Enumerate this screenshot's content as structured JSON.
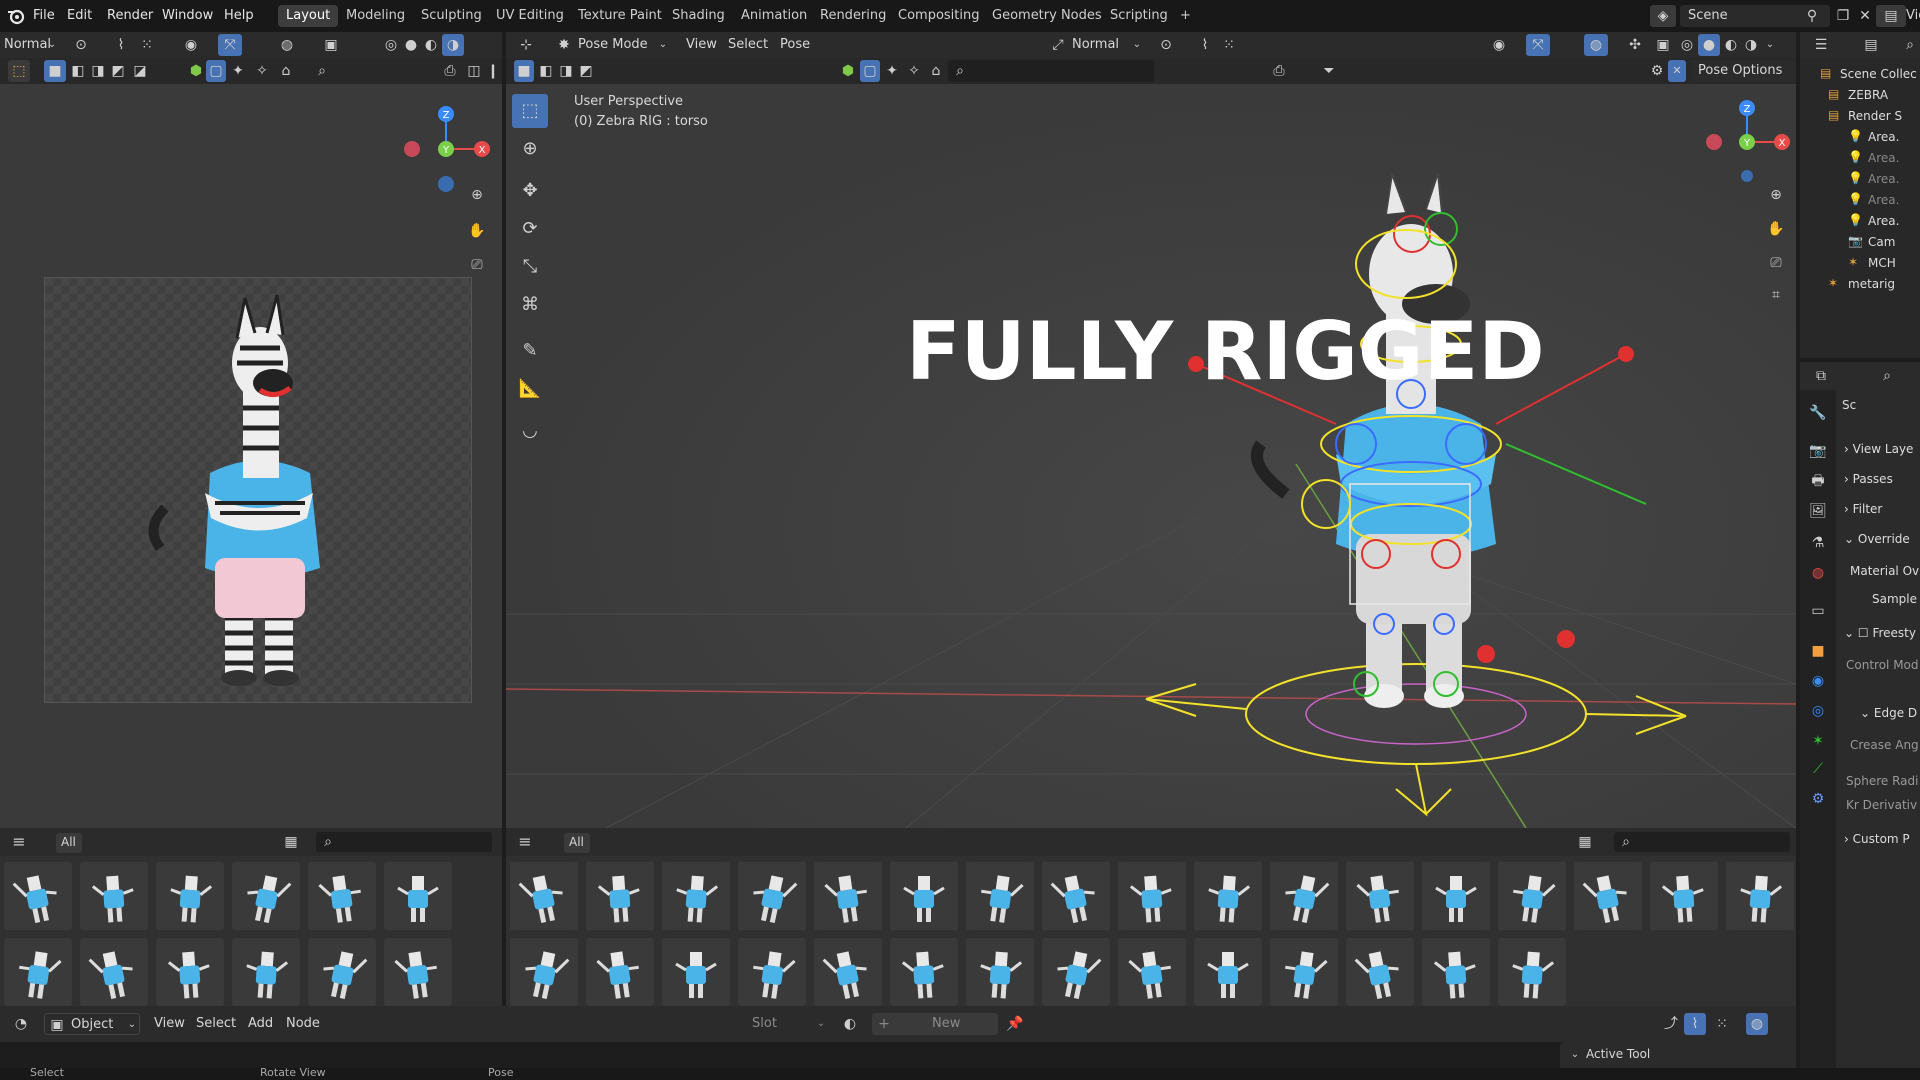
{
  "topbar": {
    "menus": [
      "File",
      "Edit",
      "Render",
      "Window",
      "Help"
    ],
    "workspaces": [
      "Layout",
      "Modeling",
      "Sculpting",
      "UV Editing",
      "Texture Paint",
      "Shading",
      "Animation",
      "Rendering",
      "Compositing",
      "Geometry Nodes",
      "Scripting",
      "+"
    ],
    "active_workspace": "Layout",
    "scene": "Scene",
    "view_layer": "Vie"
  },
  "left_editor": {
    "mode": "Normal",
    "asset_filter": "All"
  },
  "viewport": {
    "mode": "Pose Mode",
    "menus": [
      "View",
      "Select",
      "Pose"
    ],
    "orientation": "Normal",
    "pose_options": "Pose Options",
    "overlay_title": "User Perspective",
    "overlay_subtitle": "(0) Zebra RIG : torso",
    "headline": "FULLY RIGGED",
    "asset_filter": "All"
  },
  "outliner": {
    "items": [
      "Scene Collec",
      "ZEBRA",
      "Render S",
      "Area.",
      "Area.",
      "Area.",
      "Area.",
      "Area.",
      "Cam",
      "MCH",
      "metarig"
    ]
  },
  "properties": {
    "breadcrumb": "Sc",
    "sections": [
      "View Laye",
      "Passes",
      "Filter",
      "Override",
      "Material Ov",
      "Sample",
      "Freesty",
      "Control Mod",
      "Edge D",
      "Crease Ang",
      "Sphere Radi",
      "Kr Derivativ",
      "Custom P"
    ]
  },
  "bottom": {
    "editor_type": "Object",
    "menus": [
      "View",
      "Select",
      "Add",
      "Node"
    ],
    "slot": "Slot",
    "new_label": "New",
    "active_tool": "Active Tool"
  },
  "statusbar": {
    "items": [
      "Select",
      "Rotate View",
      "Pose"
    ]
  },
  "colors": {
    "accent": "#4772b3",
    "header": "#2b2b2b",
    "viewport_bg": "#3d3d3d",
    "zebra_shirt": "#4ab4e8",
    "rig_yellow": "#f2e22a",
    "rig_blue": "#3a6cff",
    "rig_red": "#e03030",
    "rig_green": "#2fbf2f"
  }
}
